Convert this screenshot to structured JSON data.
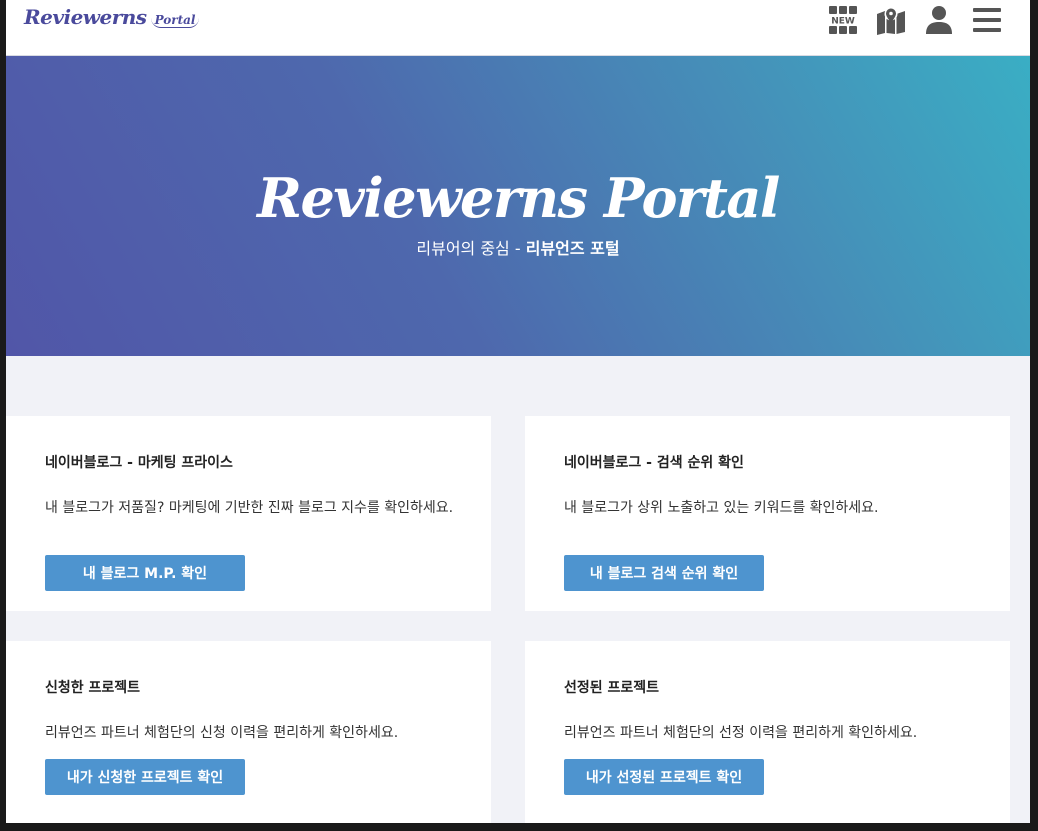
{
  "header": {
    "logo_main": "Reviewerns",
    "logo_sub": "Portal",
    "icons": [
      "new-grid-icon",
      "map-icon",
      "user-icon",
      "hamburger-menu-icon"
    ],
    "new_badge": "NEW"
  },
  "hero": {
    "title": "Reviewerns Portal",
    "subtitle_plain": "리뷰어의 중심 - ",
    "subtitle_bold": "리뷰언즈 포털"
  },
  "cards": [
    {
      "title": "네이버블로그 - 마케팅 프라이스",
      "description": "내 블로그가 저품질? 마케팅에 기반한 진짜 블로그 지수를 확인하세요.",
      "button": "내 블로그 M.P. 확인"
    },
    {
      "title": "네이버블로그 - 검색 순위 확인",
      "description": "내 블로그가 상위 노출하고 있는 키워드를 확인하세요.",
      "button": "내 블로그 검색 순위 확인"
    },
    {
      "title": "신청한 프로젝트",
      "description": "리뷰언즈 파트너 체험단의 신청 이력을 편리하게 확인하세요.",
      "button": "내가 신청한 프로젝트 확인"
    },
    {
      "title": "선정된 프로젝트",
      "description": "리뷰언즈 파트너 체험단의 선정 이력을 편리하게 확인하세요.",
      "button": "내가 선정된 프로젝트 확인"
    }
  ],
  "colors": {
    "brand": "#4a4a9c",
    "button": "#4e94cf",
    "hero_start": "#5156a8",
    "hero_end": "#3aaec4",
    "page_bg": "#f1f2f7",
    "icon": "#555555"
  }
}
